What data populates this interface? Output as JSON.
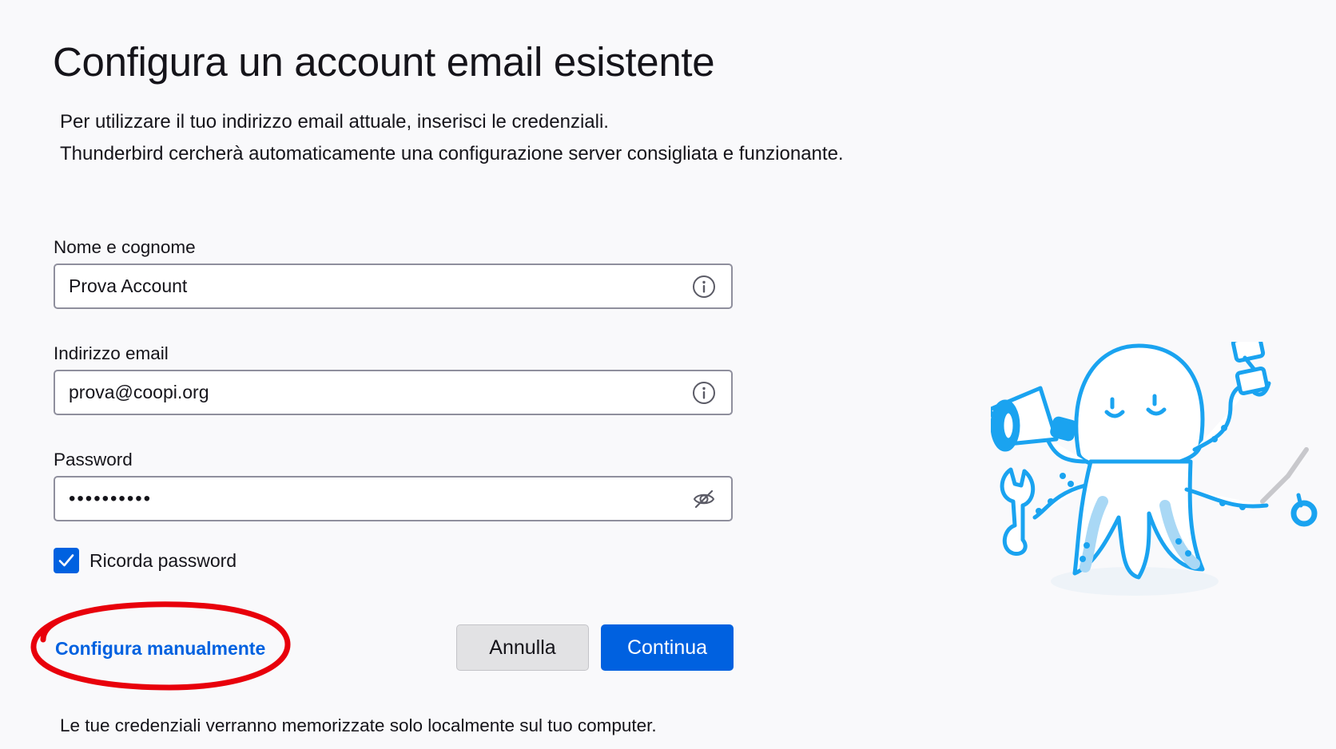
{
  "page": {
    "title": "Configura un account email esistente",
    "description": [
      "Per utilizzare il tuo indirizzo email attuale, inserisci le credenziali.",
      "Thunderbird cercherà automaticamente una configurazione server consigliata e funzionante."
    ]
  },
  "form": {
    "name": {
      "label": "Nome e cognome",
      "value": "Prova Account",
      "icon": "info-icon"
    },
    "email": {
      "label": "Indirizzo email",
      "value": "prova@coopi.org",
      "icon": "info-icon"
    },
    "password": {
      "label": "Password",
      "value": "••••••••••",
      "icon": "eye-slash-icon"
    },
    "remember": {
      "label": "Ricorda password",
      "checked": true
    }
  },
  "actions": {
    "manual_label": "Configura manualmente",
    "cancel_label": "Annulla",
    "continue_label": "Continua"
  },
  "footer": {
    "note": "Le tue credenziali verranno memorizzate solo localmente sul tuo computer."
  },
  "colors": {
    "accent": "#0061e0",
    "annotation": "#e8000b",
    "mascot": "#1aa3f0"
  }
}
